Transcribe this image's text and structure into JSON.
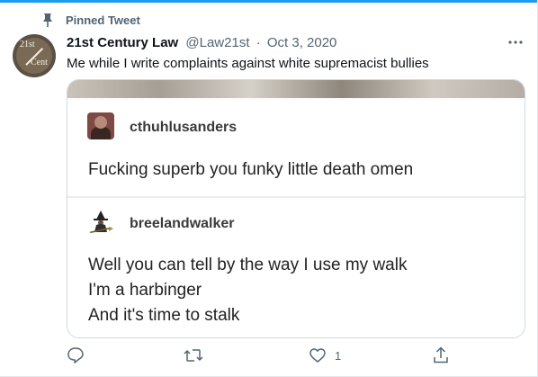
{
  "pinned": {
    "label": "Pinned Tweet"
  },
  "author": {
    "display_name": "21st Century Law",
    "handle": "@Law21st",
    "separator": "·",
    "date": "Oct 3, 2020",
    "avatar_text_top": "21st",
    "avatar_text_bottom": "Cent"
  },
  "tweet": {
    "text": "Me while I write complaints against white supremacist bullies"
  },
  "media": {
    "posts": [
      {
        "username": "cthuhlusanders",
        "text": "Fucking superb you funky little death omen"
      },
      {
        "username": "breelandwalker",
        "lines": [
          "Well you can tell by the way I use my walk",
          "I'm a harbinger",
          "And it's time to stalk"
        ]
      }
    ]
  },
  "actions": {
    "reply_count": "",
    "retweet_count": "",
    "like_count": "1",
    "share_count": ""
  },
  "colors": {
    "accent": "#1d9bf0",
    "secondary_text": "#536471",
    "border": "#cfd9de"
  },
  "icons": {
    "pin": "pin-icon",
    "more": "more-icon",
    "reply": "reply-icon",
    "retweet": "retweet-icon",
    "like": "heart-icon",
    "share": "share-icon"
  }
}
